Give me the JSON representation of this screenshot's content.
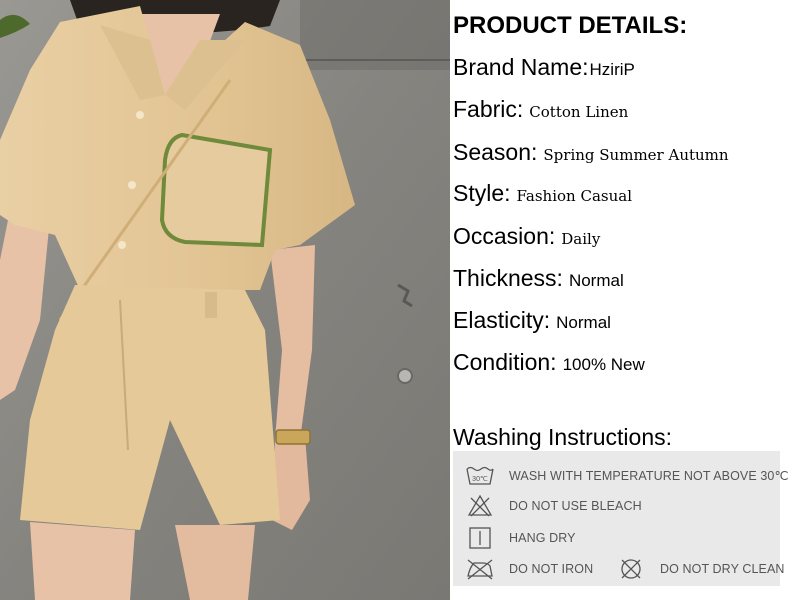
{
  "product_details": {
    "heading": "PRODUCT DETAILS:",
    "rows": [
      {
        "label": "Brand Name:",
        "value": "HziriP"
      },
      {
        "label": "Fabric:",
        "value": "Cotton Linen"
      },
      {
        "label": "Season:",
        "value": "Spring Summer Autumn"
      },
      {
        "label": "Style:",
        "value": "Fashion Casual"
      },
      {
        "label": "Occasion:",
        "value": "Daily"
      },
      {
        "label": "Thickness:",
        "value": "Normal"
      },
      {
        "label": "Elasticity:",
        "value": "Normal"
      },
      {
        "label": "Condition:",
        "value": "100% New"
      }
    ]
  },
  "washing": {
    "title": "Washing Instructions:",
    "items": [
      {
        "icon": "wash-30-icon",
        "text": "WASH WITH TEMPERATURE NOT ABOVE 30℃"
      },
      {
        "icon": "no-bleach-icon",
        "text": "DO NOT USE BLEACH"
      },
      {
        "icon": "hang-dry-icon",
        "text": "HANG DRY"
      },
      {
        "icon": "no-iron-icon",
        "text": "DO NOT IRON"
      },
      {
        "icon": "no-dry-clean-icon",
        "text": "DO NOT DRY CLEAN"
      }
    ],
    "wash_temp_label": "30℃"
  },
  "photo": {
    "icon": "model-photo",
    "colors": {
      "wall": "#8f8d88",
      "garment": "#e4c79a",
      "pocket_trim": "#6f8a3a",
      "skin": "#e7c2a6",
      "hair": "#2a2420"
    }
  }
}
